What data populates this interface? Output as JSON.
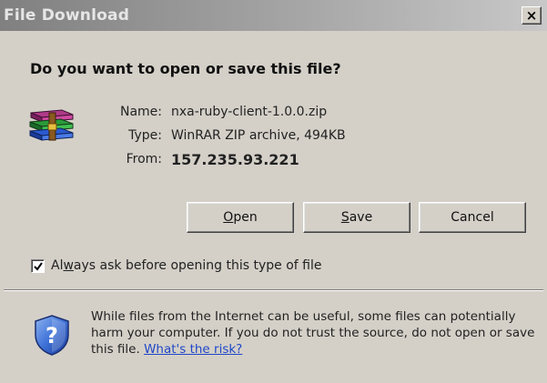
{
  "window": {
    "title": "File Download",
    "close_glyph": "×"
  },
  "question": "Do you want to open or save this file?",
  "file": {
    "name_label": "Name:",
    "name_value": "nxa-ruby-client-1.0.0.zip",
    "type_label": "Type:",
    "type_value": "WinRAR ZIP archive, 494KB",
    "from_label": "From:",
    "from_value": "157.235.93.221",
    "icon": "winrar-archive-icon"
  },
  "buttons": {
    "open_mnemonic": "O",
    "open_rest": "pen",
    "save_mnemonic": "S",
    "save_rest": "ave",
    "cancel": "Cancel"
  },
  "checkbox": {
    "label_pre": "Al",
    "label_mnemonic": "w",
    "label_post": "ays ask before opening this type of file",
    "checked": true
  },
  "warning": {
    "text": "While files from the Internet can be useful, some files can potentially harm your computer. If you do not trust the source, do not open or save this file.",
    "link": "What's the risk?",
    "icon": "security-shield-icon"
  },
  "colors": {
    "face": "#d4d0c8",
    "link": "#1f47c8"
  }
}
